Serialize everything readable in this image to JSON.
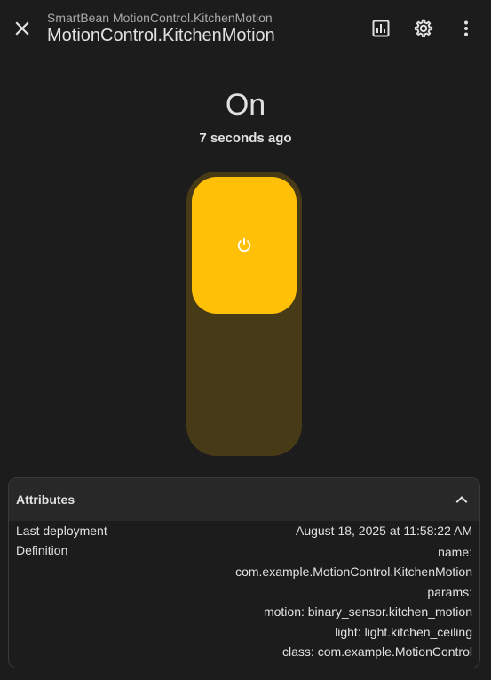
{
  "header": {
    "breadcrumb": "SmartBean MotionControl.KitchenMotion",
    "title": "MotionControl.KitchenMotion",
    "icons": {
      "close": "close-icon",
      "history": "chart-box-icon",
      "settings": "gear-icon",
      "more": "dots-vertical-icon"
    }
  },
  "main": {
    "state": "On",
    "last_changed": "7 seconds ago",
    "toggle": {
      "is_on": true,
      "icon": "power-icon",
      "on_color": "#ffc007",
      "track_color": "#473a17"
    }
  },
  "attributes": {
    "title": "Attributes",
    "expanded": true,
    "rows": [
      {
        "key": "Last deployment",
        "value": "August 18, 2025 at 11:58:22 AM"
      },
      {
        "key": "Definition",
        "lines": [
          "name:",
          "com.example.MotionControl.KitchenMotion",
          "params:",
          "motion: binary_sensor.kitchen_motion",
          "light: light.kitchen_ceiling",
          "class: com.example.MotionControl"
        ]
      }
    ]
  },
  "colors": {
    "background": "#1c1c1c",
    "text": "#e1e1e1",
    "secondary_text": "#a9a9a9",
    "accent": "#ffc007"
  }
}
